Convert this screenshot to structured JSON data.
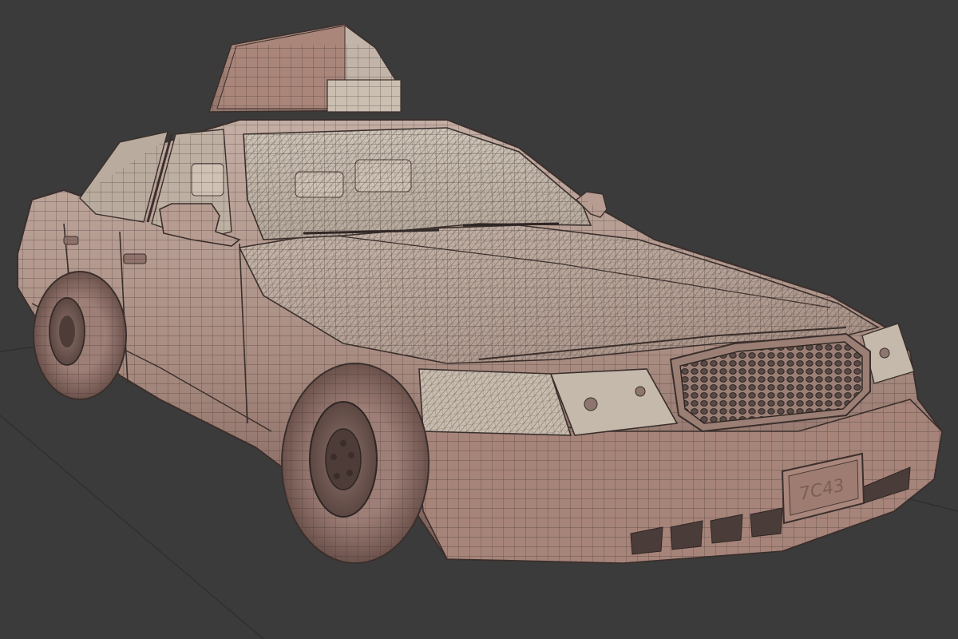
{
  "viewport": {
    "background_color": "#3b3b3b",
    "grid_line_color": "#2c2c2c"
  },
  "model": {
    "subject": "taxi-sedan-wireframe",
    "body_color": "#a98a80",
    "body_shadow_color": "#6f5650",
    "body_highlight_color": "#c8b4aa",
    "wire_color": "#3a302e",
    "glass_color": "#bfb3a6",
    "tire_color": "#8c6c66",
    "grille_color": "#3e3431",
    "roof_sign_color": "#a88277",
    "license_plate_text": "7C43"
  }
}
